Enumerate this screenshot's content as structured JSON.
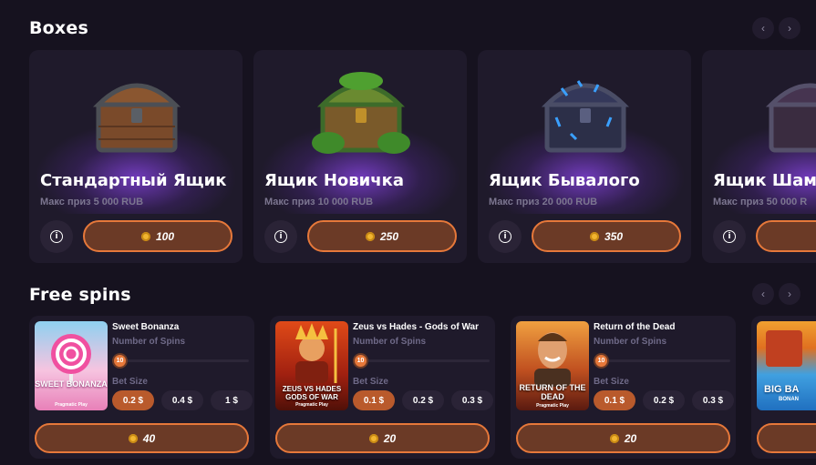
{
  "boxes": {
    "title": "Boxes",
    "prev_icon": "chevron-left-icon",
    "next_icon": "chevron-right-icon",
    "items": [
      {
        "name": "Стандартный Ящик",
        "prize": "Макс приз 5 000 RUB",
        "price": "100",
        "theme": "standard"
      },
      {
        "name": "Ящик Новичка",
        "prize": "Макс приз 10 000 RUB",
        "price": "250",
        "theme": "novice"
      },
      {
        "name": "Ящик Бывалого",
        "prize": "Макс приз 20 000 RUB",
        "price": "350",
        "theme": "veteran"
      },
      {
        "name": "Ящик Шам",
        "prize": "Макс приз 50 000 R",
        "price": "",
        "theme": "shaman"
      }
    ]
  },
  "free_spins": {
    "title": "Free spins",
    "spins_label": "Number of Spins",
    "bet_label": "Bet Size",
    "items": [
      {
        "game": "Sweet Bonanza",
        "thumb_text": "SWEET BONANZA",
        "provider": "Pragmatic Play",
        "spins": "10",
        "bets": [
          "0.2 $",
          "0.4 $",
          "1 $"
        ],
        "selected_bet": 0,
        "price": "40"
      },
      {
        "game": "Zeus vs Hades - Gods of War",
        "thumb_text": "ZEUS VS HADES GODS OF WAR",
        "provider": "Pragmatic Play",
        "spins": "10",
        "bets": [
          "0.1 $",
          "0.2 $",
          "0.3 $"
        ],
        "selected_bet": 0,
        "price": "20"
      },
      {
        "game": "Return of the Dead",
        "thumb_text": "RETURN OF THE DEAD",
        "provider": "Pragmatic Play",
        "spins": "10",
        "bets": [
          "0.1 $",
          "0.2 $",
          "0.3 $"
        ],
        "selected_bet": 0,
        "price": "20"
      },
      {
        "game": "",
        "thumb_text": "BIG BA",
        "provider": "BONAN",
        "spins": "",
        "bets": [],
        "selected_bet": 0,
        "price": ""
      }
    ]
  },
  "colors": {
    "accent": "#e6783a",
    "button_fill": "#6b3a26",
    "background": "#16121f",
    "card": "#1f1a2b",
    "coin": "#f2b530"
  }
}
